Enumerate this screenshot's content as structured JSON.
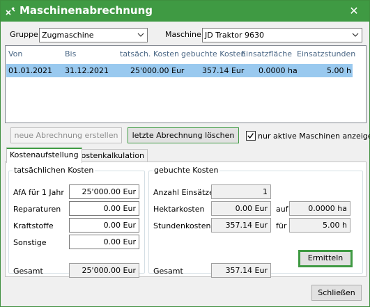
{
  "window": {
    "title": "Maschinenabrechnung"
  },
  "filters": {
    "gruppe_label": "Gruppe",
    "gruppe_value": "Zugmaschine",
    "maschine_label": "Maschine",
    "maschine_value": "JD Traktor 9630"
  },
  "table": {
    "columns": [
      "Von",
      "Bis",
      "tatsäch. Kosten",
      "gebuchte Kosten",
      "Einsatzfläche",
      "Einsatzstunden"
    ],
    "rows": [
      [
        "01.01.2021",
        "31.12.2021",
        "25'000.00 Eur",
        "357.14 Eur",
        "0.0000 ha",
        "5.00 h"
      ]
    ]
  },
  "actions": {
    "new_label": "neue Abrechnung erstellen",
    "delete_label": "letzte Abrechnung löschen",
    "active_only_label": "nur aktive Maschinen anzeigen",
    "active_only_checked": true
  },
  "tabs": [
    "Kostenaufstellung",
    "Kostenkalkulation"
  ],
  "actual_costs": {
    "title": "tatsächlichen Kosten",
    "afa_label": "AfA für 1 Jahr",
    "afa_value": "25'000.00 Eur",
    "repair_label": "Reparaturen",
    "repair_value": "0.00 Eur",
    "fuel_label": "Kraftstoffe",
    "fuel_value": "0.00 Eur",
    "other_label": "Sonstige",
    "other_value": "0.00 Eur",
    "total_label": "Gesamt",
    "total_value": "25'000.00 Eur"
  },
  "booked_costs": {
    "title": "gebuchte Kosten",
    "count_label": "Anzahl Einsätze",
    "count_value": "1",
    "hectare_label": "Hektarkosten",
    "hectare_value": "0.00 Eur",
    "auf_label": "auf",
    "area_value": "0.0000 ha",
    "hour_label": "Stundenkosten",
    "hour_value": "357.14 Eur",
    "fuer_label": "für",
    "hours_value": "5.00 h",
    "total_label": "Gesamt",
    "total_value": "357.14 Eur",
    "compute_label": "Ermitteln"
  },
  "footer": {
    "close_label": "Schließen"
  },
  "colors": {
    "accent": "#3f9a43",
    "selection": "#99c9ef"
  },
  "icons": {
    "app": "tractor-icon",
    "close": "close-icon",
    "dropdown": "chevron-down-icon",
    "check": "check-icon"
  }
}
